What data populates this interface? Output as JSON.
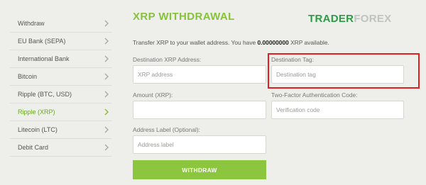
{
  "sidebar": {
    "items": [
      {
        "label": "Withdraw",
        "active": false
      },
      {
        "label": "EU Bank (SEPA)",
        "active": false
      },
      {
        "label": "International Bank",
        "active": false
      },
      {
        "label": "Bitcoin",
        "active": false
      },
      {
        "label": "Ripple (BTC, USD)",
        "active": false
      },
      {
        "label": "Ripple (XRP)",
        "active": true
      },
      {
        "label": "Litecoin (LTC)",
        "active": false
      },
      {
        "label": "Debit Card",
        "active": false
      }
    ]
  },
  "header": {
    "title": "XRP WITHDRAWAL",
    "logo_part1": "TRADER",
    "logo_part2": "FOREX"
  },
  "info": {
    "before": "Transfer XRP to your wallet address. You have ",
    "amount": "0.00000000",
    "after": " XRP available."
  },
  "form": {
    "destination_address": {
      "label": "Destination XRP Address:",
      "placeholder": "XRP address",
      "value": ""
    },
    "destination_tag": {
      "label": "Destination Tag:",
      "placeholder": "Destination tag",
      "value": ""
    },
    "amount": {
      "label": "Amount (XRP):",
      "placeholder": "",
      "value": ""
    },
    "two_factor": {
      "label": "Two-Factor Authentication Code:",
      "placeholder": "Verification code",
      "value": ""
    },
    "address_label": {
      "label": "Address Label (Optional):",
      "placeholder": "Address label",
      "value": ""
    },
    "submit_label": "WITHDRAW"
  },
  "colors": {
    "accent": "#8cc63f",
    "highlight_border": "#e02020",
    "logo_green": "#2d9b47"
  },
  "icons": {
    "sidebar_item": "chevron-right-icon"
  }
}
